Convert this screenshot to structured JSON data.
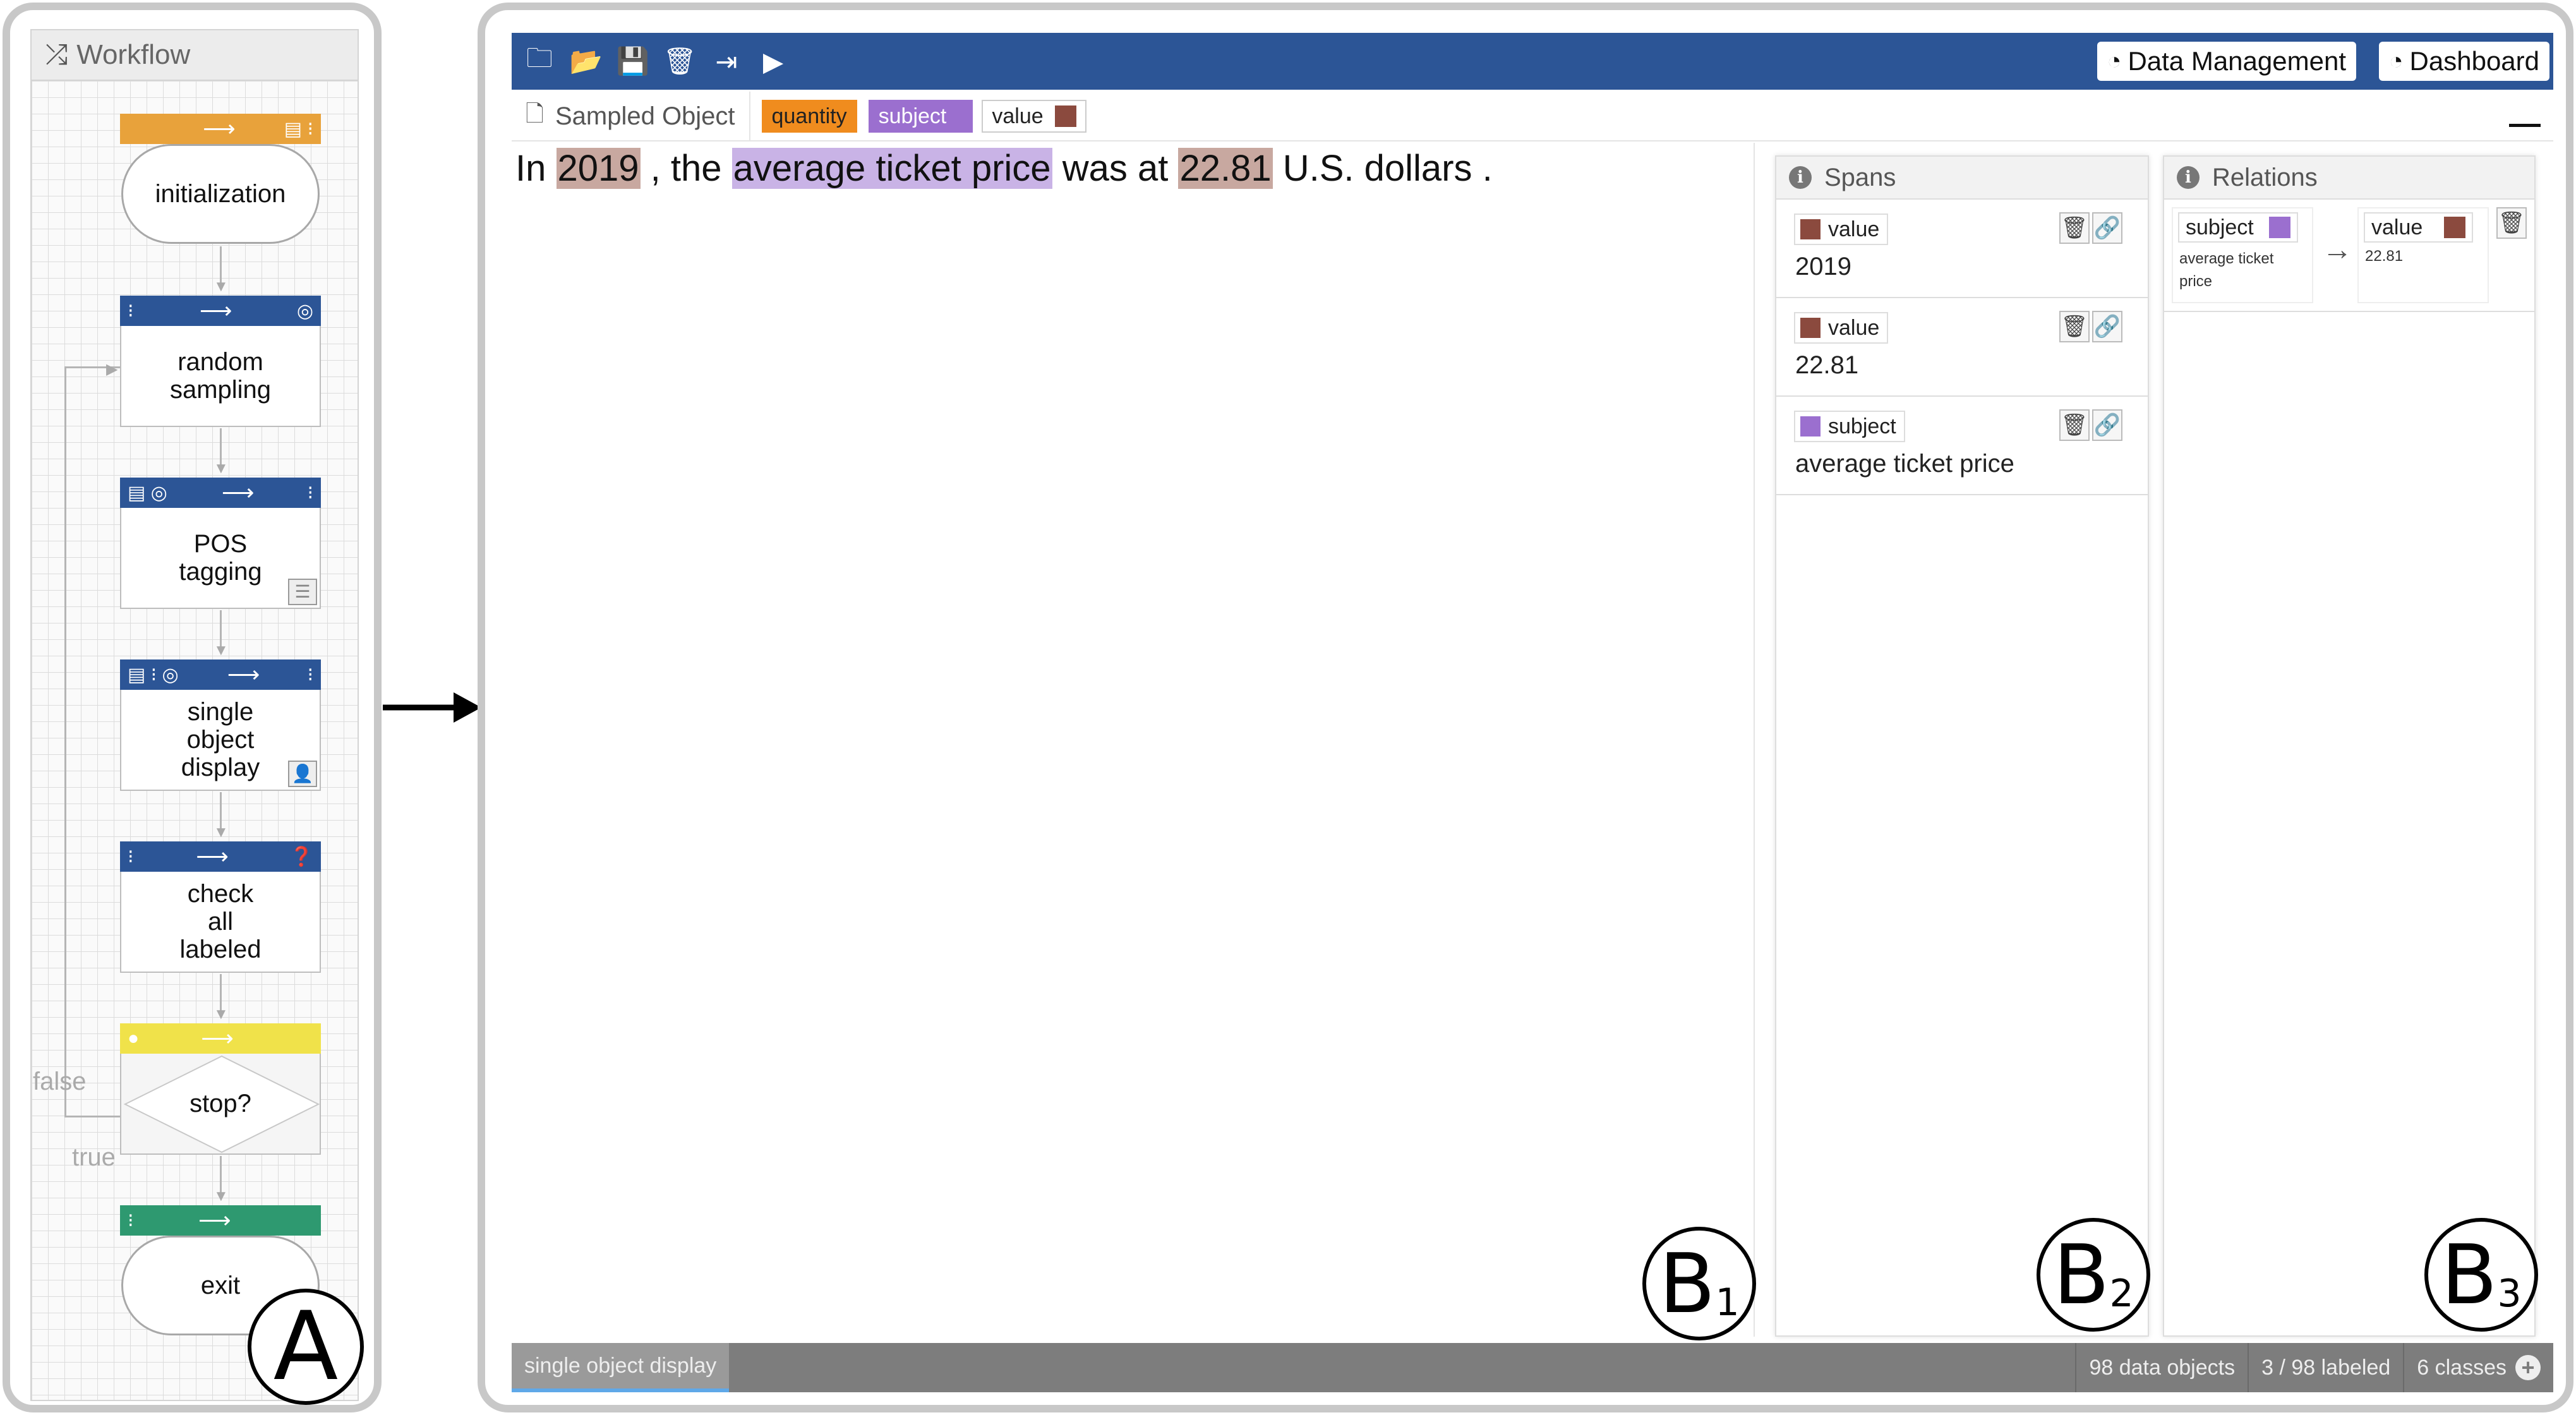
{
  "workflow": {
    "title": "Workflow",
    "nodes": [
      {
        "label": "initialization"
      },
      {
        "label": "random sampling"
      },
      {
        "label": "POS tagging"
      },
      {
        "label": "single object display"
      },
      {
        "label": "check all labeled"
      },
      {
        "label": "stop?"
      },
      {
        "label": "exit"
      }
    ],
    "edge_false": "false",
    "edge_true": "true",
    "colors": {
      "init_bar": "#e8a23b",
      "process_bar": "#2c5596",
      "decision_bar": "#f0e24a",
      "exit_bar": "#2e9970"
    },
    "panel_label": "A"
  },
  "toolbar": {
    "icons": [
      "new-folder-icon",
      "open-folder-icon",
      "save-icon",
      "trash-icon",
      "export-icon",
      "play-icon"
    ],
    "data_management": "Data Management",
    "dashboard": "Dashboard",
    "color": "#2c5596"
  },
  "tabs": {
    "sampled_object": "Sampled Object",
    "tags": [
      {
        "label": "quantity",
        "color": "#f08c1e"
      },
      {
        "label": "subject",
        "color": "#9b6fcf"
      },
      {
        "label": "value",
        "color": "#8b4a3e"
      }
    ]
  },
  "sentence": {
    "parts": [
      "In",
      "2019",
      ", the",
      "average ticket price",
      "was at",
      "22.81",
      "U.S. dollars ."
    ]
  },
  "spans": {
    "title": "Spans",
    "items": [
      {
        "label": "value",
        "text": "2019",
        "color": "#8b4a3e"
      },
      {
        "label": "value",
        "text": "22.81",
        "color": "#8b4a3e"
      },
      {
        "label": "subject",
        "text": "average ticket price",
        "color": "#9b6fcf"
      }
    ]
  },
  "relations": {
    "title": "Relations",
    "items": [
      {
        "from_label": "subject",
        "from_text": "average ticket price",
        "to_label": "value",
        "to_text": "22.81"
      }
    ]
  },
  "status": {
    "current_node": "single object display",
    "objects": "98 data objects",
    "labeled": "3 / 98 labeled",
    "classes": "6 classes"
  },
  "panel_labels": {
    "b1_letter": "B",
    "b1_sub": "1",
    "b2_letter": "B",
    "b2_sub": "2",
    "b3_letter": "B",
    "b3_sub": "3"
  }
}
